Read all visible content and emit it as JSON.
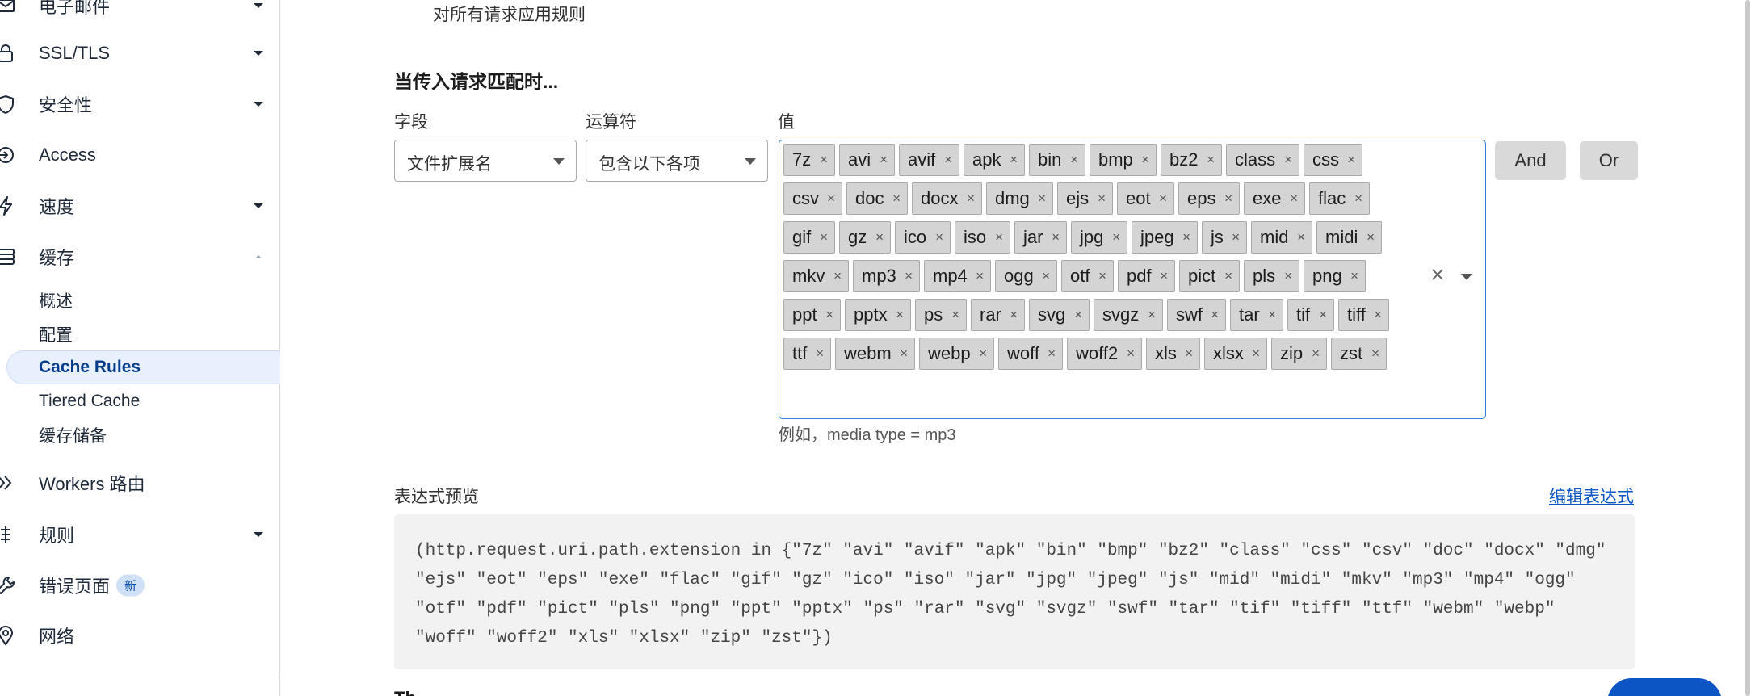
{
  "sidebar": {
    "items": [
      {
        "label": "电子邮件",
        "icon": "mail-icon",
        "expanded": false
      },
      {
        "label": "SSL/TLS",
        "icon": "lock-icon",
        "expanded": false
      },
      {
        "label": "安全性",
        "icon": "shield-icon",
        "expanded": false
      },
      {
        "label": "Access",
        "icon": "access-icon"
      },
      {
        "label": "速度",
        "icon": "lightning-icon",
        "expanded": false
      },
      {
        "label": "缓存",
        "icon": "cache-icon",
        "expanded": true
      },
      {
        "label": "Workers 路由",
        "icon": "workers-icon"
      },
      {
        "label": "规则",
        "icon": "rules-icon",
        "expanded": false
      },
      {
        "label": "错误页面",
        "icon": "wrench-icon",
        "badge": "新"
      },
      {
        "label": "网络",
        "icon": "location-pin-icon"
      }
    ],
    "cache_subitems": [
      {
        "label": "概述"
      },
      {
        "label": "配置"
      },
      {
        "label": "Cache Rules",
        "active": true
      },
      {
        "label": "Tiered Cache"
      },
      {
        "label": "缓存储备"
      }
    ]
  },
  "main": {
    "top_note": "对所有请求应用规则",
    "section_title": "当传入请求匹配时...",
    "field_label": "字段",
    "operator_label": "运算符",
    "value_label": "值",
    "field_value": "文件扩展名",
    "operator_value": "包含以下各项",
    "values": [
      "7z",
      "avi",
      "avif",
      "apk",
      "bin",
      "bmp",
      "bz2",
      "class",
      "css",
      "csv",
      "doc",
      "docx",
      "dmg",
      "ejs",
      "eot",
      "eps",
      "exe",
      "flac",
      "gif",
      "gz",
      "ico",
      "iso",
      "jar",
      "jpg",
      "jpeg",
      "js",
      "mid",
      "midi",
      "mkv",
      "mp3",
      "mp4",
      "ogg",
      "otf",
      "pdf",
      "pict",
      "pls",
      "png",
      "ppt",
      "pptx",
      "ps",
      "rar",
      "svg",
      "svgz",
      "swf",
      "tar",
      "tif",
      "tiff",
      "ttf",
      "webm",
      "webp",
      "woff",
      "woff2",
      "xls",
      "xlsx",
      "zip",
      "zst"
    ],
    "and_label": "And",
    "or_label": "Or",
    "hint": "例如，media type = mp3",
    "preview_label": "表达式预览",
    "edit_link": "编辑表达式",
    "expression": "(http.request.uri.path.extension in {\"7z\" \"avi\" \"avif\" \"apk\" \"bin\" \"bmp\" \"bz2\" \"class\" \"css\" \"csv\" \"doc\" \"docx\" \"dmg\" \"ejs\" \"eot\" \"eps\" \"exe\" \"flac\" \"gif\" \"gz\" \"ico\" \"iso\" \"jar\" \"jpg\" \"jpeg\" \"js\" \"mid\" \"midi\" \"mkv\" \"mp3\" \"mp4\" \"ogg\" \"otf\" \"pdf\" \"pict\" \"pls\" \"png\" \"ppt\" \"pptx\" \"ps\" \"rar\" \"svg\" \"svgz\" \"swf\" \"tar\" \"tif\" \"tiff\" \"ttf\" \"webm\" \"webp\" \"woff\" \"woff2\" \"xls\" \"xlsx\" \"zip\" \"zst\"})",
    "cut_off_text": "Th"
  },
  "colors": {
    "accent": "#0b55c4",
    "focus_border": "#2f7fdc",
    "tag_bg": "#d4d4d4",
    "active_nav_bg": "#e8f0fd"
  }
}
